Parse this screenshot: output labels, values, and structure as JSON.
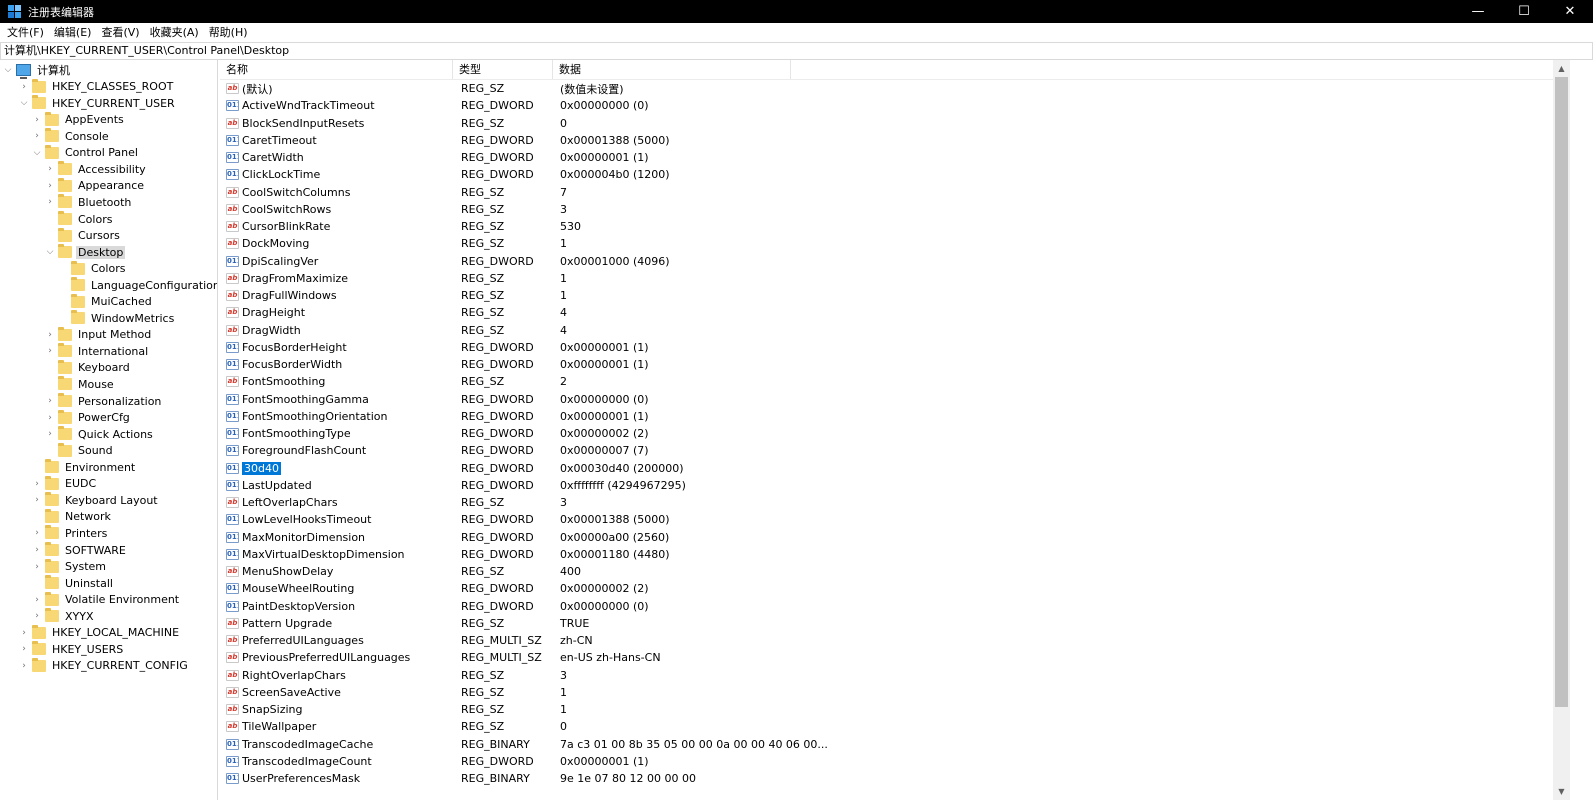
{
  "window": {
    "title": "注册表编辑器",
    "minimize": "—",
    "maximize": "☐",
    "close": "✕"
  },
  "menu": [
    "文件(F)",
    "编辑(E)",
    "查看(V)",
    "收藏夹(A)",
    "帮助(H)"
  ],
  "address": "计算机\\HKEY_CURRENT_USER\\Control Panel\\Desktop",
  "tree": {
    "root": "计算机",
    "nodes": [
      {
        "label": "HKEY_CLASSES_ROOT",
        "level": 1,
        "chev": ">"
      },
      {
        "label": "HKEY_CURRENT_USER",
        "level": 1,
        "chev": "v"
      },
      {
        "label": "AppEvents",
        "level": 2,
        "chev": ">"
      },
      {
        "label": "Console",
        "level": 2,
        "chev": ">"
      },
      {
        "label": "Control Panel",
        "level": 2,
        "chev": "v"
      },
      {
        "label": "Accessibility",
        "level": 3,
        "chev": ">"
      },
      {
        "label": "Appearance",
        "level": 3,
        "chev": ">"
      },
      {
        "label": "Bluetooth",
        "level": 3,
        "chev": ">"
      },
      {
        "label": "Colors",
        "level": 3,
        "chev": ""
      },
      {
        "label": "Cursors",
        "level": 3,
        "chev": ""
      },
      {
        "label": "Desktop",
        "level": 3,
        "chev": "v",
        "selected": true
      },
      {
        "label": "Colors",
        "level": 4,
        "chev": ""
      },
      {
        "label": "LanguageConfiguration",
        "level": 4,
        "chev": ""
      },
      {
        "label": "MuiCached",
        "level": 4,
        "chev": ""
      },
      {
        "label": "WindowMetrics",
        "level": 4,
        "chev": ""
      },
      {
        "label": "Input Method",
        "level": 3,
        "chev": ">"
      },
      {
        "label": "International",
        "level": 3,
        "chev": ">"
      },
      {
        "label": "Keyboard",
        "level": 3,
        "chev": ""
      },
      {
        "label": "Mouse",
        "level": 3,
        "chev": ""
      },
      {
        "label": "Personalization",
        "level": 3,
        "chev": ">"
      },
      {
        "label": "PowerCfg",
        "level": 3,
        "chev": ">"
      },
      {
        "label": "Quick Actions",
        "level": 3,
        "chev": ">"
      },
      {
        "label": "Sound",
        "level": 3,
        "chev": ""
      },
      {
        "label": "Environment",
        "level": 2,
        "chev": ""
      },
      {
        "label": "EUDC",
        "level": 2,
        "chev": ">"
      },
      {
        "label": "Keyboard Layout",
        "level": 2,
        "chev": ">"
      },
      {
        "label": "Network",
        "level": 2,
        "chev": ""
      },
      {
        "label": "Printers",
        "level": 2,
        "chev": ">"
      },
      {
        "label": "SOFTWARE",
        "level": 2,
        "chev": ">"
      },
      {
        "label": "System",
        "level": 2,
        "chev": ">"
      },
      {
        "label": "Uninstall",
        "level": 2,
        "chev": ""
      },
      {
        "label": "Volatile Environment",
        "level": 2,
        "chev": ">"
      },
      {
        "label": "XYYX",
        "level": 2,
        "chev": ">"
      },
      {
        "label": "HKEY_LOCAL_MACHINE",
        "level": 1,
        "chev": ">"
      },
      {
        "label": "HKEY_USERS",
        "level": 1,
        "chev": ">"
      },
      {
        "label": "HKEY_CURRENT_CONFIG",
        "level": 1,
        "chev": ">"
      }
    ]
  },
  "columns": {
    "name": "名称",
    "type": "类型",
    "data": "数据"
  },
  "values": [
    {
      "icon": "sz",
      "name": "(默认)",
      "type": "REG_SZ",
      "data": "(数值未设置)"
    },
    {
      "icon": "bin",
      "name": "ActiveWndTrackTimeout",
      "type": "REG_DWORD",
      "data": "0x00000000 (0)"
    },
    {
      "icon": "sz",
      "name": "BlockSendInputResets",
      "type": "REG_SZ",
      "data": "0"
    },
    {
      "icon": "bin",
      "name": "CaretTimeout",
      "type": "REG_DWORD",
      "data": "0x00001388 (5000)"
    },
    {
      "icon": "bin",
      "name": "CaretWidth",
      "type": "REG_DWORD",
      "data": "0x00000001 (1)"
    },
    {
      "icon": "bin",
      "name": "ClickLockTime",
      "type": "REG_DWORD",
      "data": "0x000004b0 (1200)"
    },
    {
      "icon": "sz",
      "name": "CoolSwitchColumns",
      "type": "REG_SZ",
      "data": "7"
    },
    {
      "icon": "sz",
      "name": "CoolSwitchRows",
      "type": "REG_SZ",
      "data": "3"
    },
    {
      "icon": "sz",
      "name": "CursorBlinkRate",
      "type": "REG_SZ",
      "data": "530"
    },
    {
      "icon": "sz",
      "name": "DockMoving",
      "type": "REG_SZ",
      "data": "1"
    },
    {
      "icon": "bin",
      "name": "DpiScalingVer",
      "type": "REG_DWORD",
      "data": "0x00001000 (4096)"
    },
    {
      "icon": "sz",
      "name": "DragFromMaximize",
      "type": "REG_SZ",
      "data": "1"
    },
    {
      "icon": "sz",
      "name": "DragFullWindows",
      "type": "REG_SZ",
      "data": "1"
    },
    {
      "icon": "sz",
      "name": "DragHeight",
      "type": "REG_SZ",
      "data": "4"
    },
    {
      "icon": "sz",
      "name": "DragWidth",
      "type": "REG_SZ",
      "data": "4"
    },
    {
      "icon": "bin",
      "name": "FocusBorderHeight",
      "type": "REG_DWORD",
      "data": "0x00000001 (1)"
    },
    {
      "icon": "bin",
      "name": "FocusBorderWidth",
      "type": "REG_DWORD",
      "data": "0x00000001 (1)"
    },
    {
      "icon": "sz",
      "name": "FontSmoothing",
      "type": "REG_SZ",
      "data": "2"
    },
    {
      "icon": "bin",
      "name": "FontSmoothingGamma",
      "type": "REG_DWORD",
      "data": "0x00000000 (0)"
    },
    {
      "icon": "bin",
      "name": "FontSmoothingOrientation",
      "type": "REG_DWORD",
      "data": "0x00000001 (1)"
    },
    {
      "icon": "bin",
      "name": "FontSmoothingType",
      "type": "REG_DWORD",
      "data": "0x00000002 (2)"
    },
    {
      "icon": "bin",
      "name": "ForegroundFlashCount",
      "type": "REG_DWORD",
      "data": "0x00000007 (7)"
    },
    {
      "icon": "bin",
      "name": "30d40",
      "type": "REG_DWORD",
      "data": "0x00030d40 (200000)",
      "highlight": true
    },
    {
      "icon": "bin",
      "name": "LastUpdated",
      "type": "REG_DWORD",
      "data": "0xffffffff (4294967295)"
    },
    {
      "icon": "sz",
      "name": "LeftOverlapChars",
      "type": "REG_SZ",
      "data": "3"
    },
    {
      "icon": "bin",
      "name": "LowLevelHooksTimeout",
      "type": "REG_DWORD",
      "data": "0x00001388 (5000)"
    },
    {
      "icon": "bin",
      "name": "MaxMonitorDimension",
      "type": "REG_DWORD",
      "data": "0x00000a00 (2560)"
    },
    {
      "icon": "bin",
      "name": "MaxVirtualDesktopDimension",
      "type": "REG_DWORD",
      "data": "0x00001180 (4480)"
    },
    {
      "icon": "sz",
      "name": "MenuShowDelay",
      "type": "REG_SZ",
      "data": "400"
    },
    {
      "icon": "bin",
      "name": "MouseWheelRouting",
      "type": "REG_DWORD",
      "data": "0x00000002 (2)"
    },
    {
      "icon": "bin",
      "name": "PaintDesktopVersion",
      "type": "REG_DWORD",
      "data": "0x00000000 (0)"
    },
    {
      "icon": "sz",
      "name": "Pattern Upgrade",
      "type": "REG_SZ",
      "data": "TRUE"
    },
    {
      "icon": "sz",
      "name": "PreferredUILanguages",
      "type": "REG_MULTI_SZ",
      "data": "zh-CN"
    },
    {
      "icon": "sz",
      "name": "PreviousPreferredUILanguages",
      "type": "REG_MULTI_SZ",
      "data": "en-US zh-Hans-CN"
    },
    {
      "icon": "sz",
      "name": "RightOverlapChars",
      "type": "REG_SZ",
      "data": "3"
    },
    {
      "icon": "sz",
      "name": "ScreenSaveActive",
      "type": "REG_SZ",
      "data": "1"
    },
    {
      "icon": "sz",
      "name": "SnapSizing",
      "type": "REG_SZ",
      "data": "1"
    },
    {
      "icon": "sz",
      "name": "TileWallpaper",
      "type": "REG_SZ",
      "data": "0"
    },
    {
      "icon": "bin",
      "name": "TranscodedImageCache",
      "type": "REG_BINARY",
      "data": "7a c3 01 00 8b 35 05 00 00 0a 00 00 40 06 00..."
    },
    {
      "icon": "bin",
      "name": "TranscodedImageCount",
      "type": "REG_DWORD",
      "data": "0x00000001 (1)"
    },
    {
      "icon": "bin",
      "name": "UserPreferencesMask",
      "type": "REG_BINARY",
      "data": "9e 1e 07 80 12 00 00 00"
    }
  ]
}
